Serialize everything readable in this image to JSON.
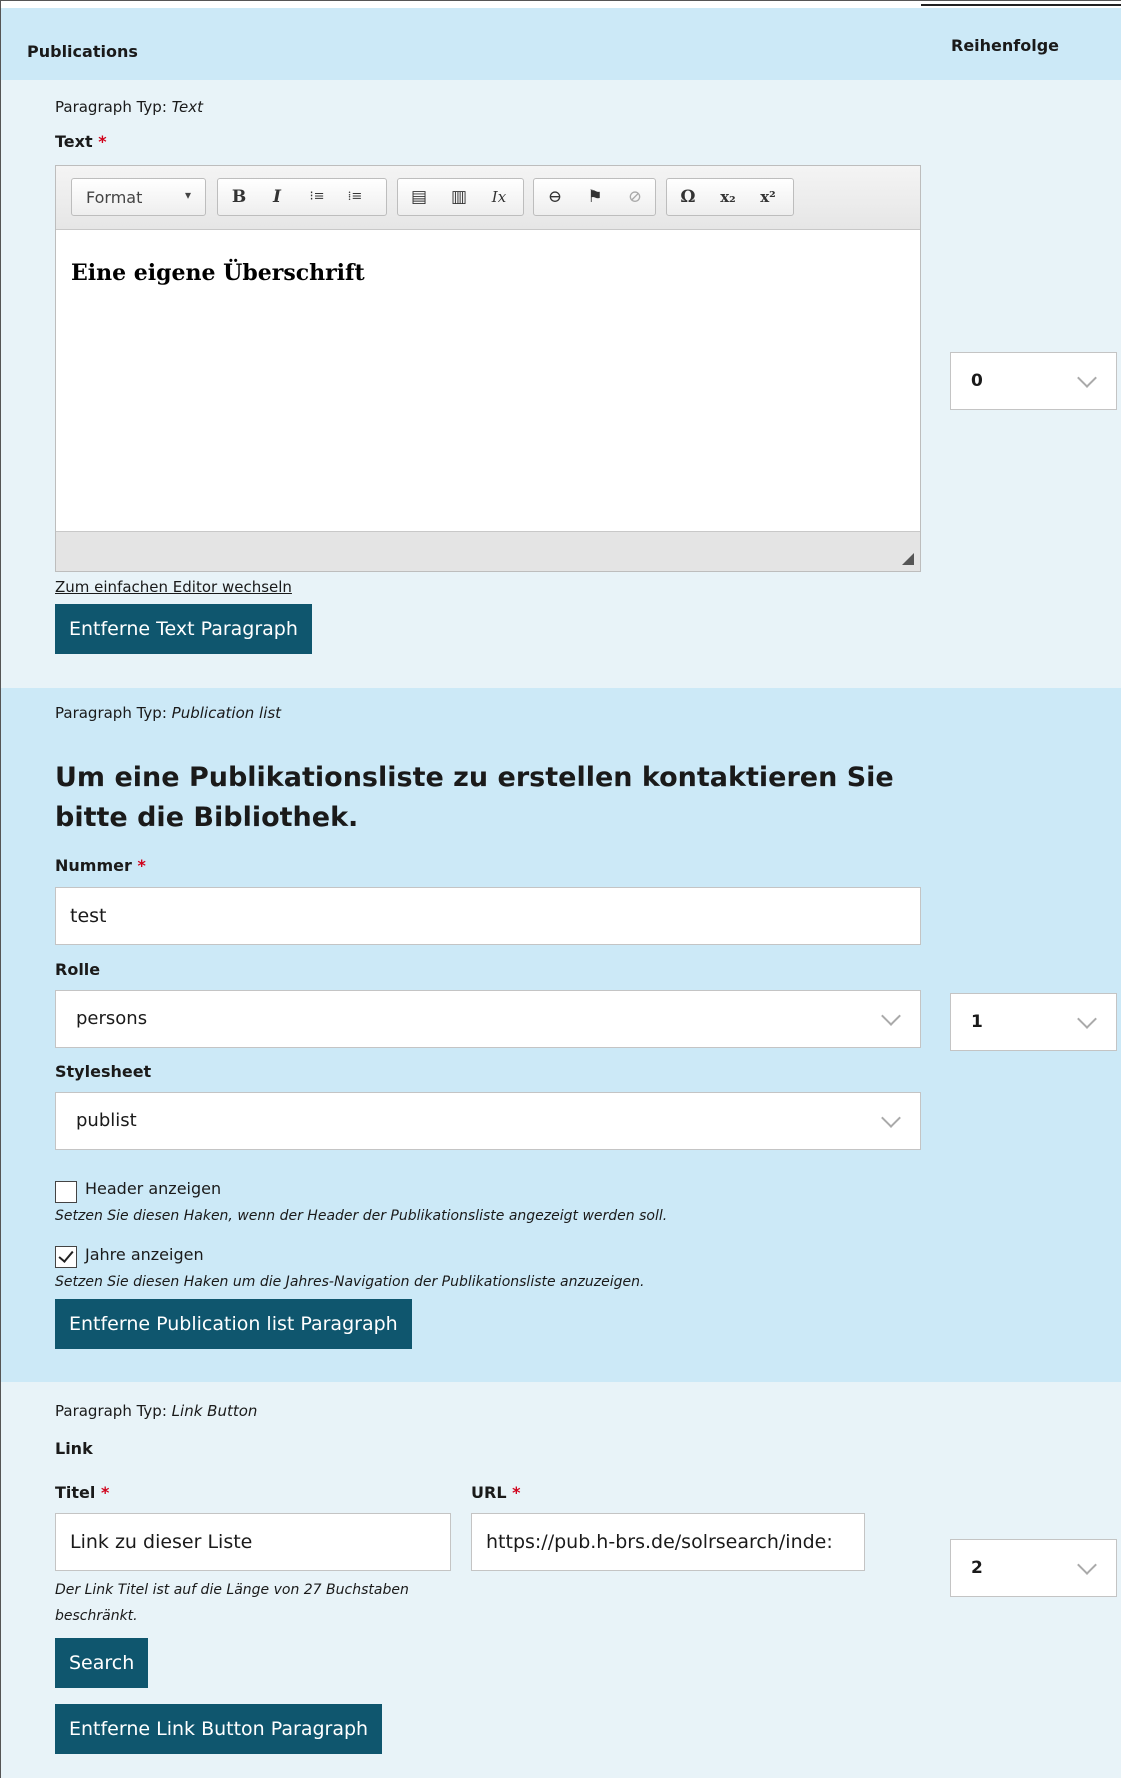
{
  "header": {
    "title": "Publications",
    "order_label": "Reihenfolge"
  },
  "text_paragraph": {
    "type_prefix": "Paragraph Typ:",
    "type_name": "Text",
    "field_label": "Text",
    "required_mark": "*",
    "toolbar": {
      "format_label": "Format",
      "format_caret": "▾",
      "bold": "B",
      "italic": "I",
      "bullet_list": "⁝≡",
      "numbered_list": "⁞≡",
      "paste_text": "▤",
      "paste_word": "▥",
      "remove_format": "Ix",
      "link": "⊖",
      "anchor": "⚑",
      "unlink": "⊘",
      "special_char": "Ω",
      "subscript": "x₂",
      "superscript": "x²"
    },
    "content": "Eine eigene Überschrift",
    "switch_editor_link": "Zum einfachen Editor wechseln",
    "remove_button": "Entferne Text Paragraph",
    "order_value": "0"
  },
  "publication_paragraph": {
    "type_prefix": "Paragraph Typ:",
    "type_name": "Publication list",
    "heading": "Um eine Publikationsliste zu erstellen kontaktieren Sie bitte die Bibliothek.",
    "nummer_label": "Nummer",
    "required_mark": "*",
    "nummer_value": "test",
    "rolle_label": "Rolle",
    "rolle_value": "persons",
    "stylesheet_label": "Stylesheet",
    "stylesheet_value": "publist",
    "header_checkbox_label": "Header anzeigen",
    "header_checkbox_checked": false,
    "header_hint": "Setzen Sie diesen Haken, wenn der Header der Publikationsliste angezeigt werden soll.",
    "jahre_checkbox_label": "Jahre anzeigen",
    "jahre_checkbox_checked": true,
    "jahre_hint": "Setzen Sie diesen Haken um die Jahres-Navigation der Publikationsliste anzuzeigen.",
    "remove_button": "Entferne Publication list Paragraph",
    "order_value": "1"
  },
  "link_paragraph": {
    "type_prefix": "Paragraph Typ:",
    "type_name": "Link Button",
    "section_label": "Link",
    "titel_label": "Titel",
    "url_label": "URL",
    "required_mark": "*",
    "titel_value": "Link zu dieser Liste",
    "url_value": "https://pub.h-brs.de/solrsearch/inde:",
    "titel_hint": "Der Link Titel ist auf die Länge von 27 Buchstaben beschränkt.",
    "search_button": "Search",
    "remove_button": "Entferne Link Button Paragraph",
    "order_value": "2"
  }
}
